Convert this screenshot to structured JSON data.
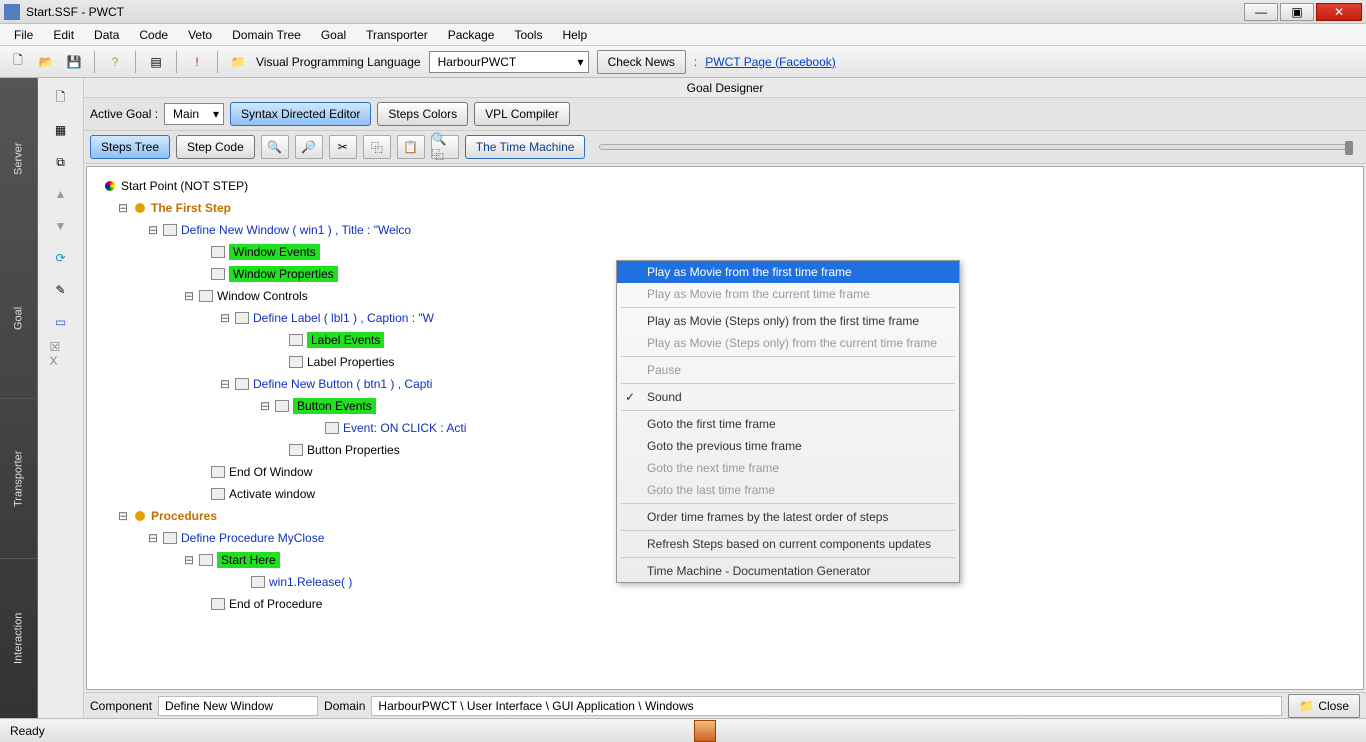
{
  "title": "Start.SSF - PWCT",
  "menu": [
    "File",
    "Edit",
    "Data",
    "Code",
    "Veto",
    "Domain Tree",
    "Goal",
    "Transporter",
    "Package",
    "Tools",
    "Help"
  ],
  "toolbar1": {
    "vpl_label": "Visual Programming Language",
    "combo_value": "HarbourPWCT",
    "check_news": "Check News",
    "link_sep": ":",
    "link": "PWCT Page (Facebook)"
  },
  "sidetabs": [
    "Server",
    "Goal",
    "Transporter",
    "Interaction"
  ],
  "panel_title": "Goal Designer",
  "toolbar2": {
    "active_goal_label": "Active Goal :",
    "active_goal_value": "Main",
    "syntax_editor": "Syntax Directed Editor",
    "steps_colors": "Steps Colors",
    "vpl_compiler": "VPL Compiler"
  },
  "toolbar3": {
    "steps_tree": "Steps Tree",
    "step_code": "Step Code",
    "time_machine": "The Time Machine"
  },
  "tree": {
    "root": "Start Point (NOT STEP)",
    "first_step": "The First Step",
    "def_window": "Define New Window  ( win1 ) , Title : \"Welco",
    "win_events": "Window Events",
    "win_props": "Window Properties",
    "win_controls": "Window Controls",
    "def_label": "Define Label ( lbl1 ) , Caption : \"W",
    "label_events": "Label Events",
    "label_props": "Label Properties",
    "def_button": "Define New Button ( btn1 ) , Capti",
    "button_events": "Button Events",
    "event_onclick": "Event: ON CLICK : Acti",
    "button_props": "Button Properties",
    "end_window": "End Of Window",
    "activate_window": "Activate window",
    "procedures": "Procedures",
    "def_proc": "Define Procedure MyClose",
    "start_here": "Start Here",
    "win_release": "win1.Release( )",
    "end_proc": "End of Procedure"
  },
  "context_menu": [
    {
      "label": "Play as Movie from the first time frame",
      "state": "highlight"
    },
    {
      "label": "Play as Movie from the current time frame",
      "state": "disabled"
    },
    {
      "sep": true
    },
    {
      "label": "Play as Movie (Steps only) from the first time frame",
      "state": "normal"
    },
    {
      "label": "Play as Movie (Steps only) from the current time frame",
      "state": "disabled"
    },
    {
      "sep": true
    },
    {
      "label": "Pause",
      "state": "disabled"
    },
    {
      "sep": true
    },
    {
      "label": "Sound",
      "state": "checked"
    },
    {
      "sep": true
    },
    {
      "label": "Goto the first time frame",
      "state": "normal"
    },
    {
      "label": "Goto the previous time frame",
      "state": "normal"
    },
    {
      "label": "Goto the next time frame",
      "state": "disabled"
    },
    {
      "label": "Goto the last time frame",
      "state": "disabled"
    },
    {
      "sep": true
    },
    {
      "label": "Order time frames by the latest order of steps",
      "state": "normal"
    },
    {
      "sep": true
    },
    {
      "label": "Refresh Steps based on current components updates",
      "state": "normal"
    },
    {
      "sep": true
    },
    {
      "label": "Time Machine - Documentation Generator",
      "state": "normal"
    }
  ],
  "statusrow": {
    "component_label": "Component",
    "component_value": "Define New Window",
    "domain_label": "Domain",
    "domain_value": "HarbourPWCT  \\  User Interface  \\  GUI Application  \\  Windows",
    "close": "Close"
  },
  "statusbar": {
    "ready": "Ready"
  }
}
